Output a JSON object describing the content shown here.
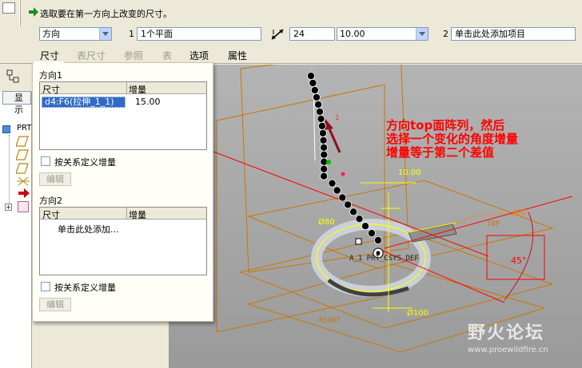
{
  "message": {
    "text": "选取要在第一方向上改变的尺寸。"
  },
  "dashboard": {
    "direction_combo": "方向",
    "dir1_number": "1",
    "dir1_reference": "1个平面",
    "count": "24",
    "spacing": "10.00",
    "dir2_number": "2",
    "dir2_reference": "单击此处添加项目",
    "tabs": [
      "尺寸",
      "表尺寸",
      "参照",
      "表",
      "选项",
      "属性"
    ]
  },
  "tree": {
    "show_button": "显示",
    "root_label": "PRT"
  },
  "panel": {
    "dir1": {
      "title": "方向1",
      "col_dim": "尺寸",
      "col_inc": "增量",
      "row_dim": "d4:F6(拉伸_1_1)",
      "row_inc": "15.00",
      "checkbox_label": "按关系定义增量",
      "edit_label": "编辑"
    },
    "dir2": {
      "title": "方向2",
      "col_dim": "尺寸",
      "col_inc": "增量",
      "add_row": "单击此处添加...",
      "checkbox_label": "按关系定义增量",
      "edit_label": "编辑"
    }
  },
  "viewport": {
    "annotation_lines": [
      "方向top面阵列，然后",
      "选择一个变化的角度增量",
      "增量等于第二个差值"
    ],
    "labels": {
      "one": "1",
      "dim_10": "10.00",
      "dim_80": "Ø80",
      "dim_100": "Ø100",
      "dim_800": "800",
      "csys": "A_1 PRT_CSYS_DEF",
      "right": "RIGHT",
      "top": "TOP",
      "angle": "45°"
    }
  },
  "watermark": {
    "text": "野火论坛",
    "url": "www.proewildfire.cn"
  },
  "colors": {
    "annotation": "#ff0000",
    "selection": "#316ac5",
    "dim_yellow": "#ffff00",
    "datum_orange": "#c87800"
  }
}
